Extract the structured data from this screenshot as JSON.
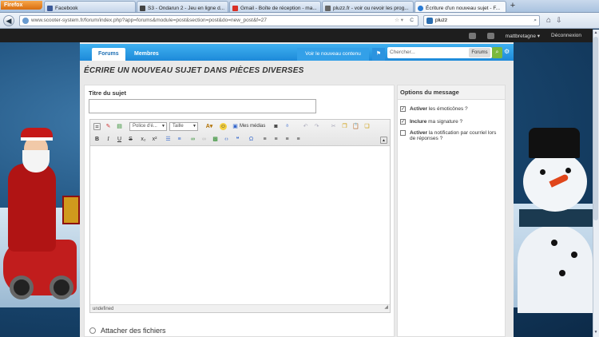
{
  "browser": {
    "menu_button": "Firefox",
    "tabs": [
      {
        "label": "Facebook",
        "color": "#3b5998"
      },
      {
        "label": "S3 - Ondarun 2 - Jeu en ligne d...",
        "color": "#444444"
      },
      {
        "label": "Gmail - Boîte de réception - ma...",
        "color": "#d93025"
      },
      {
        "label": "pluzz.fr - voir ou revoir les prog...",
        "color": "#666666"
      },
      {
        "label": "Écriture d'un nouveau sujet - F...",
        "color": "#2a7bd4"
      }
    ],
    "new_tab": "+",
    "url": "www.scooter-system.fr/forum/index.php?app=forums&module=post&section=post&do=new_post&f=27",
    "search_value": "pluzz"
  },
  "userbar": {
    "username": "mattbretagne",
    "logout": "Déconnexion"
  },
  "sitenav": {
    "tabs": [
      "Forums",
      "Membres"
    ],
    "new_content": "Voir le nouveau contenu",
    "search_placeholder": "Chercher...",
    "search_scope": "Forums"
  },
  "page": {
    "title": "Écrire un nouveau sujet dans Pièces diverses"
  },
  "form": {
    "title_label": "Titre du sujet",
    "title_value": "",
    "font_select": "Police d'é...",
    "size_select": "Taille",
    "media_button": "Mes médias",
    "status": "undefined",
    "attach": "Attacher des fichiers"
  },
  "options": {
    "header": "Options du message",
    "items": [
      {
        "bold": "Activer",
        "rest": " les émoticônes ?",
        "checked": true
      },
      {
        "bold": "Inclure",
        "rest": " ma signature ?",
        "checked": true
      },
      {
        "bold": "Activer",
        "rest": " la notification par courriel lors de réponses ?",
        "checked": false
      }
    ]
  }
}
